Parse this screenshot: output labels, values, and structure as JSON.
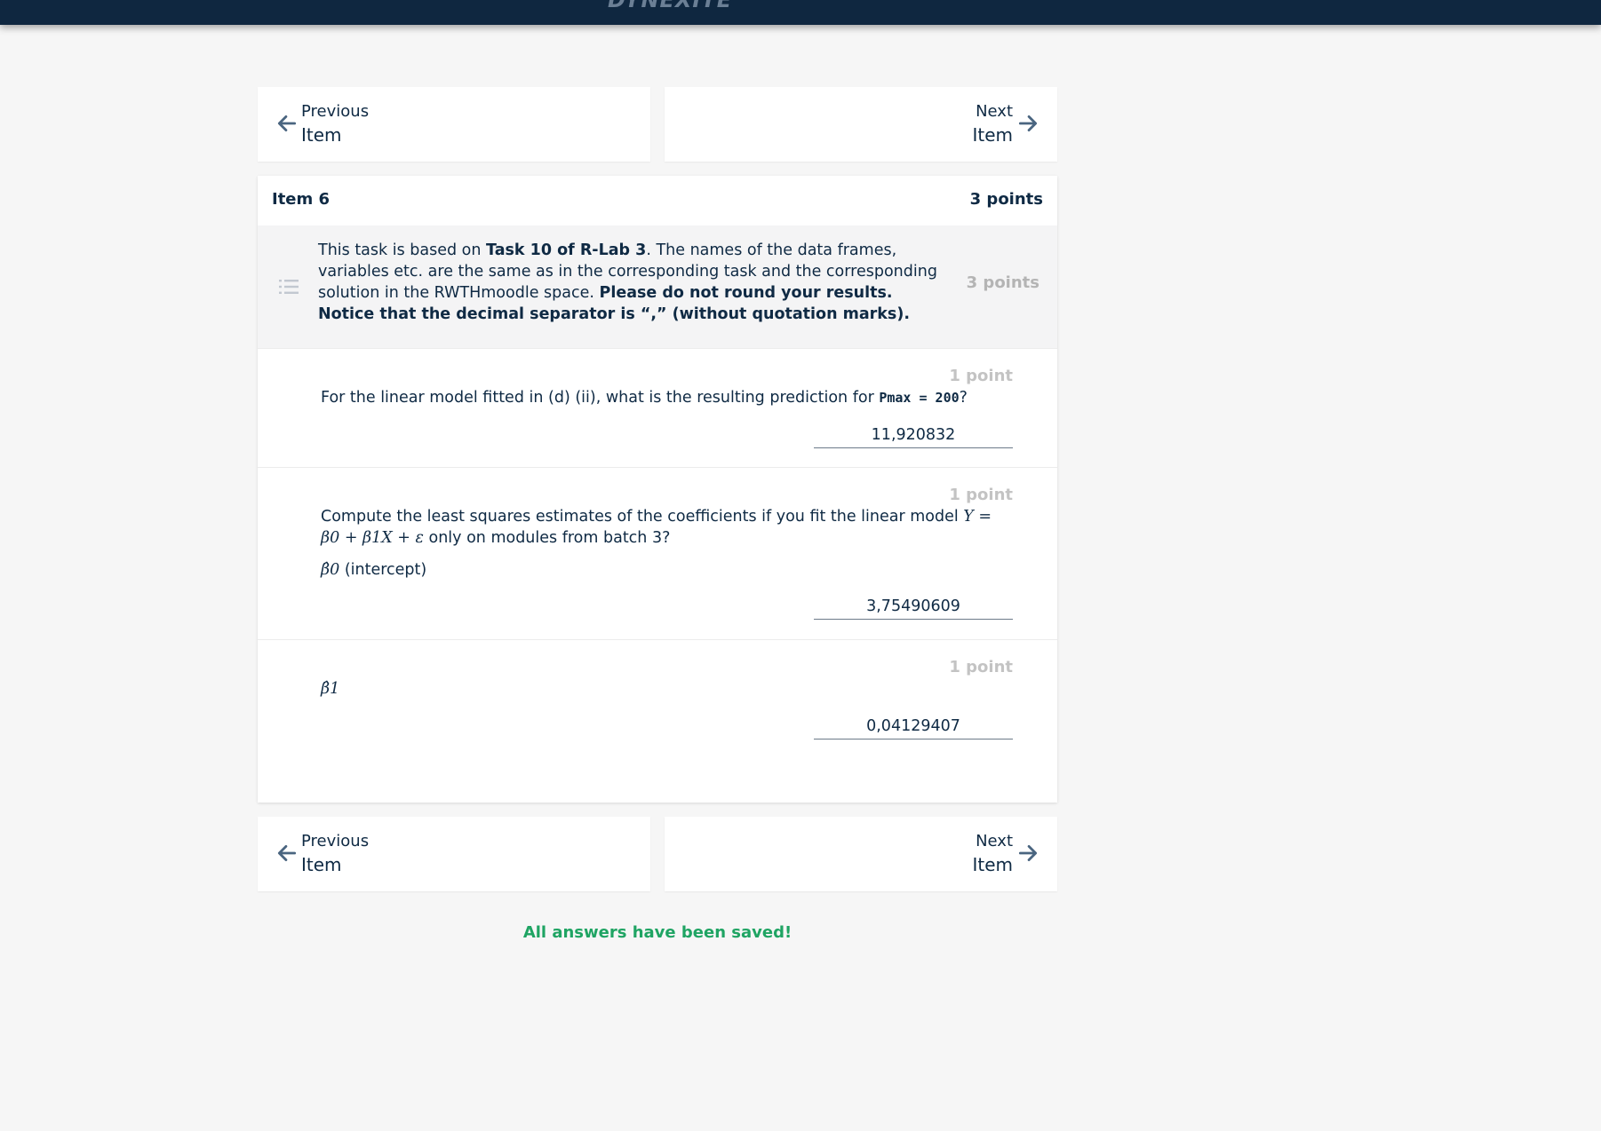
{
  "header": {
    "logo_text": "DYNEXITE"
  },
  "nav": {
    "prev_line1": "Previous",
    "prev_line2": "Item",
    "next_line1": "Next",
    "next_line2": "Item"
  },
  "item": {
    "title": "Item 6",
    "points": "3 points",
    "intro": {
      "part1": "This task is based on ",
      "bold1": "Task 10 of R-Lab 3",
      "part2": ". The names of the data frames, variables etc. are the same as in the corresponding task and the corresponding solution in the RWTHmoodle space. ",
      "bold2": "Please do not round your results. Notice that the decimal separator is “,” (without quotation marks).",
      "points": "3 points"
    },
    "questions": [
      {
        "points": "1 point",
        "text_before": "For the linear model fitted in (d) (ii), what is the resulting prediction for ",
        "code": "Pmax = 200",
        "text_after": "?",
        "answer": "11,920832"
      },
      {
        "points": "1 point",
        "text_before": "Compute the least squares estimates of the coefficients if you fit the linear model ",
        "formula": "Y = β0 + β1X + ε",
        "text_after": " only on modules from batch 3?",
        "sublabel_symbol": "β̂0",
        "sublabel_text": " (intercept)",
        "answer": "3,75490609"
      },
      {
        "points": "1 point",
        "sublabel_symbol": "β̂1",
        "answer": "0,04129407"
      }
    ]
  },
  "status": {
    "saved": "All answers have been saved!"
  },
  "colors": {
    "navy": "#0f2740",
    "accent_green": "#1fa463",
    "muted": "#b4b4b4"
  },
  "icons": {
    "prev": "arrow-left-icon",
    "next": "arrow-right-icon",
    "intro": "list-icon"
  }
}
